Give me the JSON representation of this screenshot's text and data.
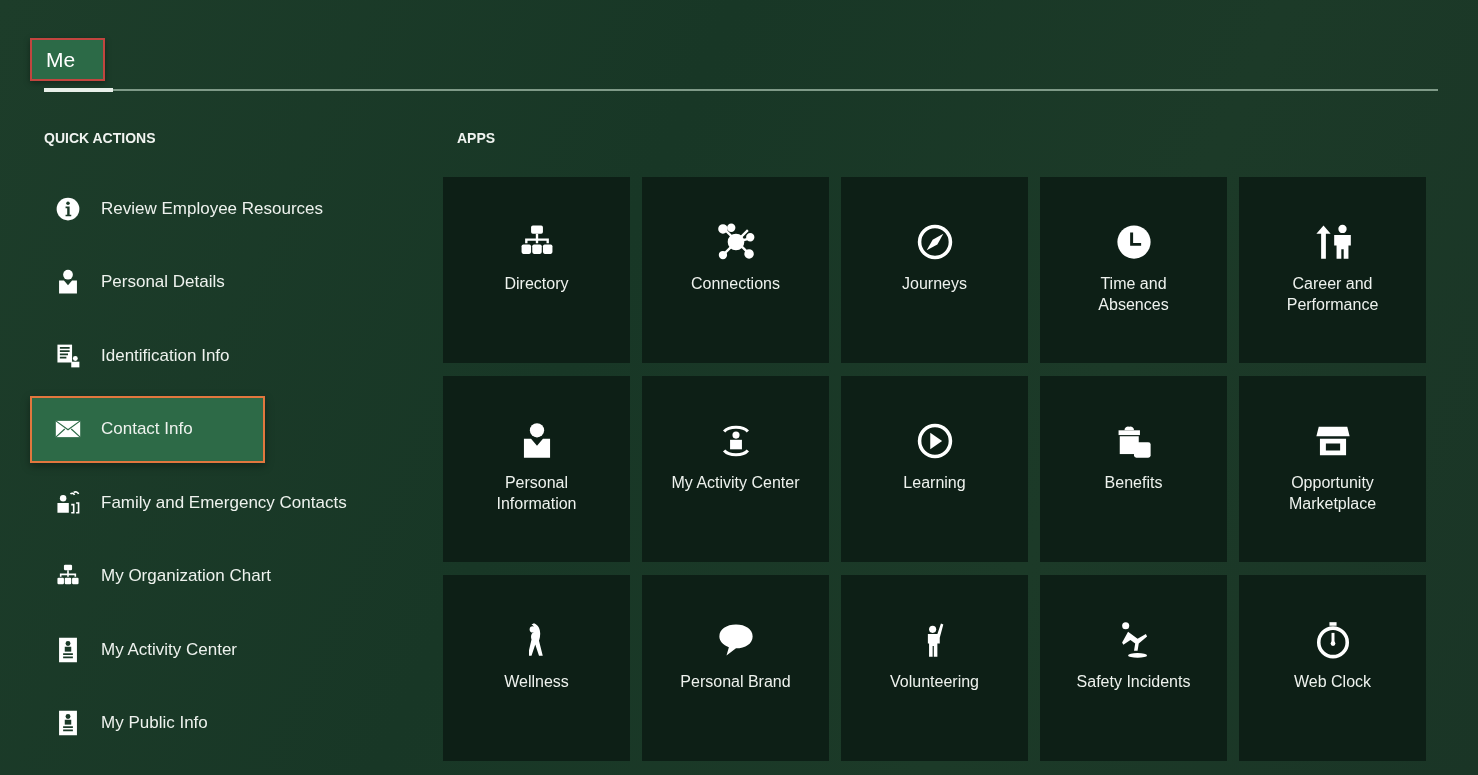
{
  "tabs": [
    {
      "label": "Me",
      "selected": true
    }
  ],
  "quick_actions": {
    "heading": "QUICK ACTIONS",
    "items": [
      {
        "label": "Review Employee Resources",
        "selected": false
      },
      {
        "label": "Personal Details",
        "selected": false
      },
      {
        "label": "Identification Info",
        "selected": false
      },
      {
        "label": "Contact Info",
        "selected": true
      },
      {
        "label": "Family and Emergency Contacts",
        "selected": false
      },
      {
        "label": "My Organization Chart",
        "selected": false
      },
      {
        "label": "My Activity Center",
        "selected": false
      },
      {
        "label": "My Public Info",
        "selected": false
      }
    ]
  },
  "apps": {
    "heading": "APPS",
    "tiles": [
      {
        "label": "Directory"
      },
      {
        "label": "Connections"
      },
      {
        "label": "Journeys"
      },
      {
        "label": "Time and Absences"
      },
      {
        "label": "Career and Performance"
      },
      {
        "label": "Personal Information"
      },
      {
        "label": "My Activity Center"
      },
      {
        "label": "Learning"
      },
      {
        "label": "Benefits"
      },
      {
        "label": "Opportunity Marketplace"
      },
      {
        "label": "Wellness"
      },
      {
        "label": "Personal Brand"
      },
      {
        "label": "Volunteering"
      },
      {
        "label": "Safety Incidents"
      },
      {
        "label": "Web Clock"
      }
    ]
  }
}
